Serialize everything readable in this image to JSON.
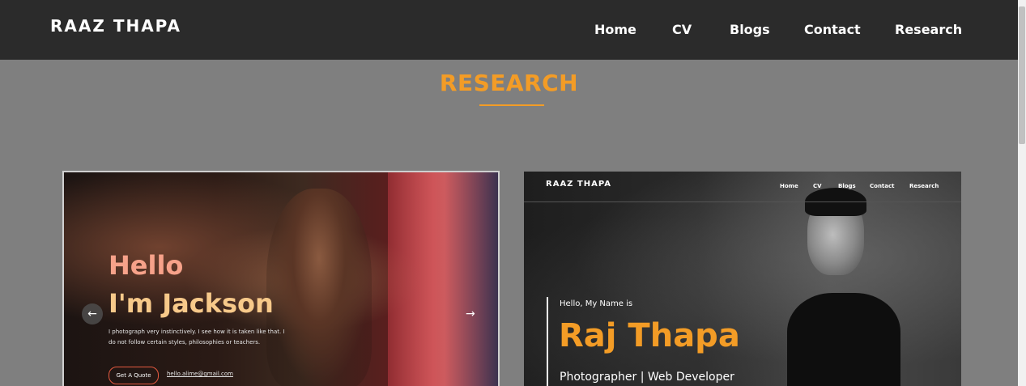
{
  "header": {
    "brand": "RAAZ THAPA",
    "nav": [
      "Home",
      "CV",
      "Blogs",
      "Contact",
      "Research"
    ]
  },
  "section": {
    "title": "RESEARCH"
  },
  "card1": {
    "hello": "Hello",
    "name": "I'm Jackson",
    "description": "I photograph very instinctively. I see how it is taken like that. I do not follow certain styles, philosophies or teachers.",
    "button": "Get A Quote",
    "email": "hello.alime@gmail.com",
    "prev_icon": "arrow-left-icon",
    "next_icon": "arrow-right-icon"
  },
  "card2": {
    "brand": "RAAZ THAPA",
    "nav": [
      "Home",
      "CV",
      "Blogs",
      "Contact",
      "Research"
    ],
    "intro": "Hello, My Name is",
    "name": "Raj Thapa",
    "roles": "Photographer | Web Developer"
  },
  "colors": {
    "accent": "#f39c26",
    "navbar": "#2b2b2b",
    "page_bg": "#7f7f7f"
  }
}
